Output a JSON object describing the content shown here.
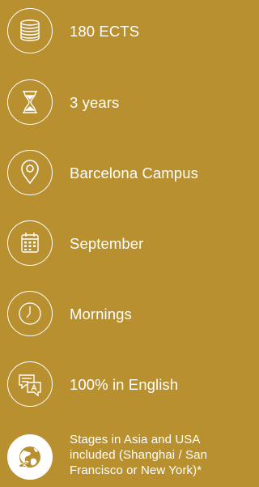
{
  "colors": {
    "background": "#b8902f",
    "foreground": "#ffffff"
  },
  "facts": [
    {
      "icon": "coins-icon",
      "label": "180 ECTS"
    },
    {
      "icon": "hourglass-icon",
      "label": "3 years"
    },
    {
      "icon": "location-pin-icon",
      "label": "Barcelona Campus"
    },
    {
      "icon": "calendar-icon",
      "label": "September"
    },
    {
      "icon": "clock-icon",
      "label": "Mornings"
    },
    {
      "icon": "chat-bubbles-icon",
      "label": "100% in English"
    },
    {
      "icon": "globe-plane-icon",
      "label": "Stages in Asia and USA included (Shanghai / San Francisco or New York)*"
    }
  ]
}
